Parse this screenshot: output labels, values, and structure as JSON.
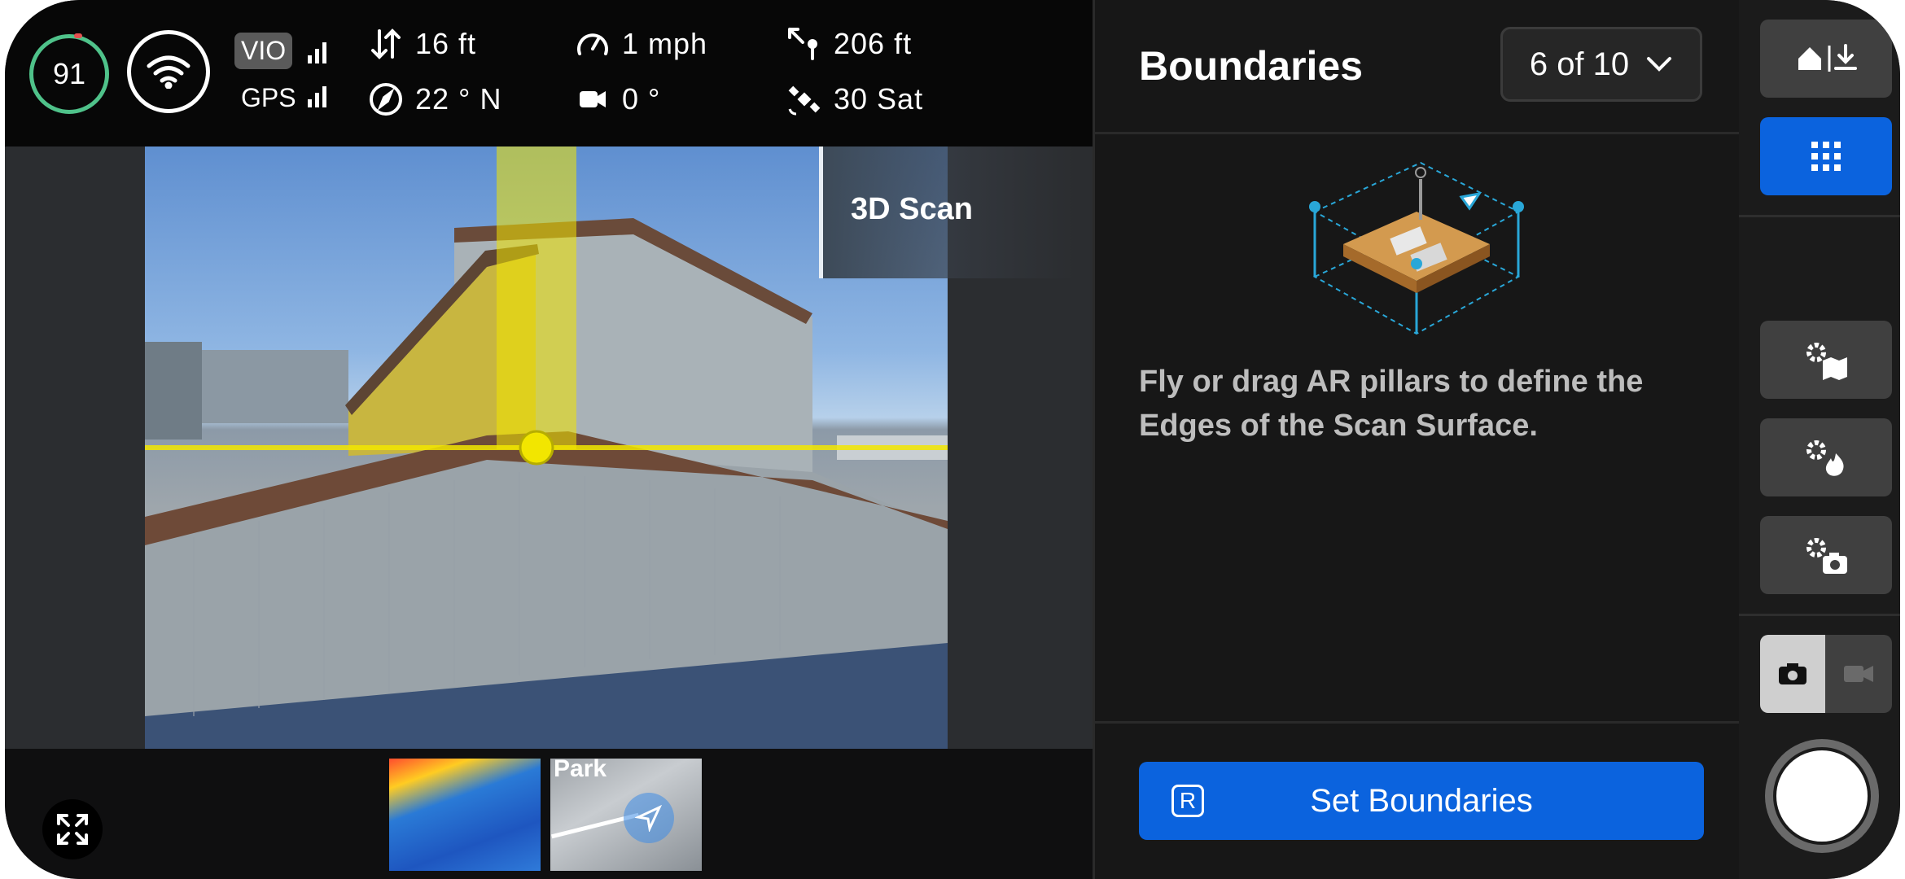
{
  "status": {
    "battery_level": "91",
    "vio_label": "VIO",
    "gps_label": "GPS",
    "telemetry": {
      "vertical": "16 ft",
      "speed": "1 mph",
      "distance": "206 ft",
      "heading": "22 ° N",
      "gimbal": "0 °",
      "satellites": "30 Sat"
    }
  },
  "viewport": {
    "mode_tab": "3D Scan"
  },
  "minimap": {
    "label": "Park"
  },
  "panel": {
    "title": "Boundaries",
    "step": "6 of 10",
    "instruction": "Fly or drag AR pillars to define the Edges of the Scan Surface.",
    "action_label": "Set Boundaries",
    "action_key": "R"
  },
  "colors": {
    "accent": "#0b63de",
    "ar_yellow": "#f2e600",
    "battery_ring": "#4fc28a"
  }
}
